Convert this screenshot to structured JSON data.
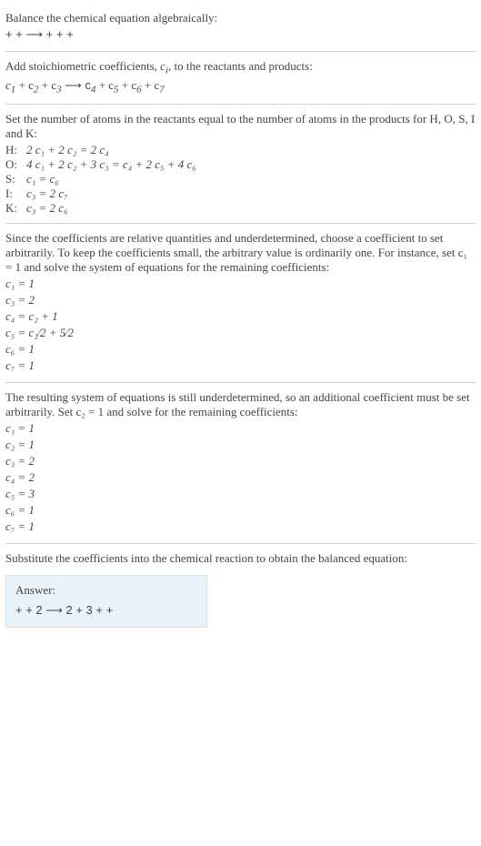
{
  "intro": {
    "l1": "Balance the chemical equation algebraically:",
    "l2": " +  +   ⟶   +  +  + "
  },
  "stoich": {
    "l1": "Add stoichiometric coefficients, ",
    "ci": "c",
    "cisub": "i",
    "l1b": ", to the reactants and products:",
    "l2a": "c",
    "l2a_s": "1",
    "l2b": "  + c",
    "l2b_s": "2",
    "l2c": "  + c",
    "l2c_s": "3",
    "l2arrow": "   ⟶  c",
    "l2d_s": "4",
    "l2e": "  + c",
    "l2e_s": "5",
    "l2f": "  + c",
    "l2f_s": "6",
    "l2g": "  + c",
    "l2g_s": "7"
  },
  "atoms": {
    "l1": "Set the number of atoms in the reactants equal to the number of atoms in the products for H, O, S, I and K:",
    "rows": [
      {
        "label": "H:",
        "eq": "2 c₁ + 2 c₂ = 2 c₄"
      },
      {
        "label": "O:",
        "eq": "4 c₁ + 2 c₂ + 3 c₃ = c₄ + 2 c₅ + 4 c₆"
      },
      {
        "label": "S:",
        "eq": "c₁ = c₆"
      },
      {
        "label": "I:",
        "eq": "c₃ = 2 c₇"
      },
      {
        "label": "K:",
        "eq": "c₃ = 2 c₆"
      }
    ]
  },
  "under1": {
    "p": "Since the coefficients are relative quantities and underdetermined, choose a coefficient to set arbitrarily. To keep the coefficients small, the arbitrary value is ordinarily one. For instance, set c₁ = 1 and solve the system of equations for the remaining coefficients:",
    "eqs": [
      "c₁ = 1",
      "c₃ = 2",
      "c₄ = c₂ + 1",
      "c₅ = c₂⁄2 + 5⁄2",
      "c₆ = 1",
      "c₇ = 1"
    ]
  },
  "under2": {
    "p": "The resulting system of equations is still underdetermined, so an additional coefficient must be set arbitrarily. Set c₂ = 1 and solve for the remaining coefficients:",
    "eqs": [
      "c₁ = 1",
      "c₂ = 1",
      "c₃ = 2",
      "c₄ = 2",
      "c₅ = 3",
      "c₆ = 1",
      "c₇ = 1"
    ]
  },
  "subst": {
    "p": "Substitute the coefficients into the chemical reaction to obtain the balanced equation:"
  },
  "answer": {
    "title": "Answer:",
    "eq": " +  + 2  ⟶  2  + 3  +  + "
  }
}
